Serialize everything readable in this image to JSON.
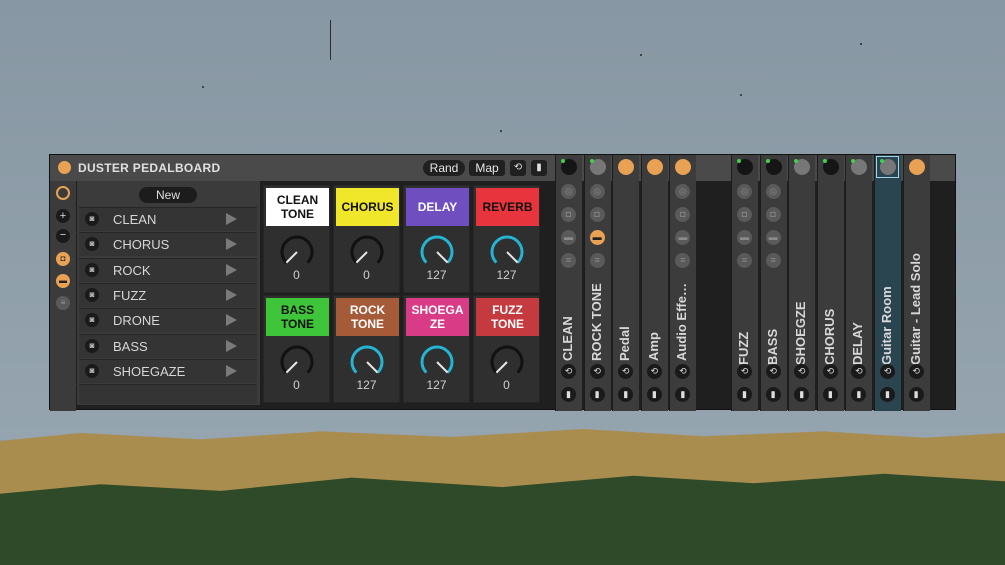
{
  "app": {
    "title": "DUSTER PEDALBOARD",
    "rand_label": "Rand",
    "map_label": "Map"
  },
  "snapshots": {
    "new_label": "New",
    "items": [
      {
        "label": "CLEAN"
      },
      {
        "label": "CHORUS"
      },
      {
        "label": "ROCK"
      },
      {
        "label": "FUZZ"
      },
      {
        "label": "DRONE"
      },
      {
        "label": "BASS"
      },
      {
        "label": "SHOEGAZE"
      }
    ]
  },
  "macros": [
    {
      "label": "CLEAN TONE",
      "value": "0",
      "bg": "#ffffff",
      "fg": "#111111",
      "level": 0
    },
    {
      "label": "CHORUS",
      "value": "0",
      "bg": "#f0e62a",
      "fg": "#111111",
      "level": 0
    },
    {
      "label": "DELAY",
      "value": "127",
      "bg": "#6f4fc0",
      "fg": "#ffffff",
      "level": 1
    },
    {
      "label": "REVERB",
      "value": "127",
      "bg": "#e8343d",
      "fg": "#111111",
      "level": 1
    },
    {
      "label": "BASS TONE",
      "value": "0",
      "bg": "#3fc53a",
      "fg": "#111111",
      "level": 0
    },
    {
      "label": "ROCK TONE",
      "value": "127",
      "bg": "#a55a38",
      "fg": "#ffffff",
      "level": 1
    },
    {
      "label": "SHOEGA ZE",
      "value": "127",
      "bg": "#d93b86",
      "fg": "#ffffff",
      "level": 1
    },
    {
      "label": "FUZZ TONE",
      "value": "0",
      "bg": "#c53a3f",
      "fg": "#ffffff",
      "level": 0
    }
  ],
  "chains_left": [
    {
      "name": "CLEAN",
      "dot": "#151515",
      "led": true
    },
    {
      "name": "ROCK TONE",
      "dot": "#777777",
      "led": true
    },
    {
      "name": "Pedal",
      "dot": "#e9a154",
      "led": false
    },
    {
      "name": "Amp",
      "dot": "#e9a154",
      "led": false
    },
    {
      "name": "Audio Effe…",
      "dot": "#e9a154",
      "led": false
    }
  ],
  "chains_right": [
    {
      "name": "FUZZ",
      "dot": "#151515",
      "led": true
    },
    {
      "name": "BASS",
      "dot": "#151515",
      "led": true
    },
    {
      "name": "SHOEGZE",
      "dot": "#777777",
      "led": true
    },
    {
      "name": "CHORUS",
      "dot": "#151515",
      "led": true
    },
    {
      "name": "DELAY",
      "dot": "#777777",
      "led": true
    },
    {
      "name": "Guitar Room",
      "dot": "#777777",
      "led": true,
      "selected": true
    },
    {
      "name": "Guitar - Lead Solo",
      "dot": "#e9a154",
      "led": false
    }
  ],
  "colors": {
    "accent": "#e9a154",
    "knob_active": "#27b4d3",
    "led_green": "#3ed34a"
  }
}
